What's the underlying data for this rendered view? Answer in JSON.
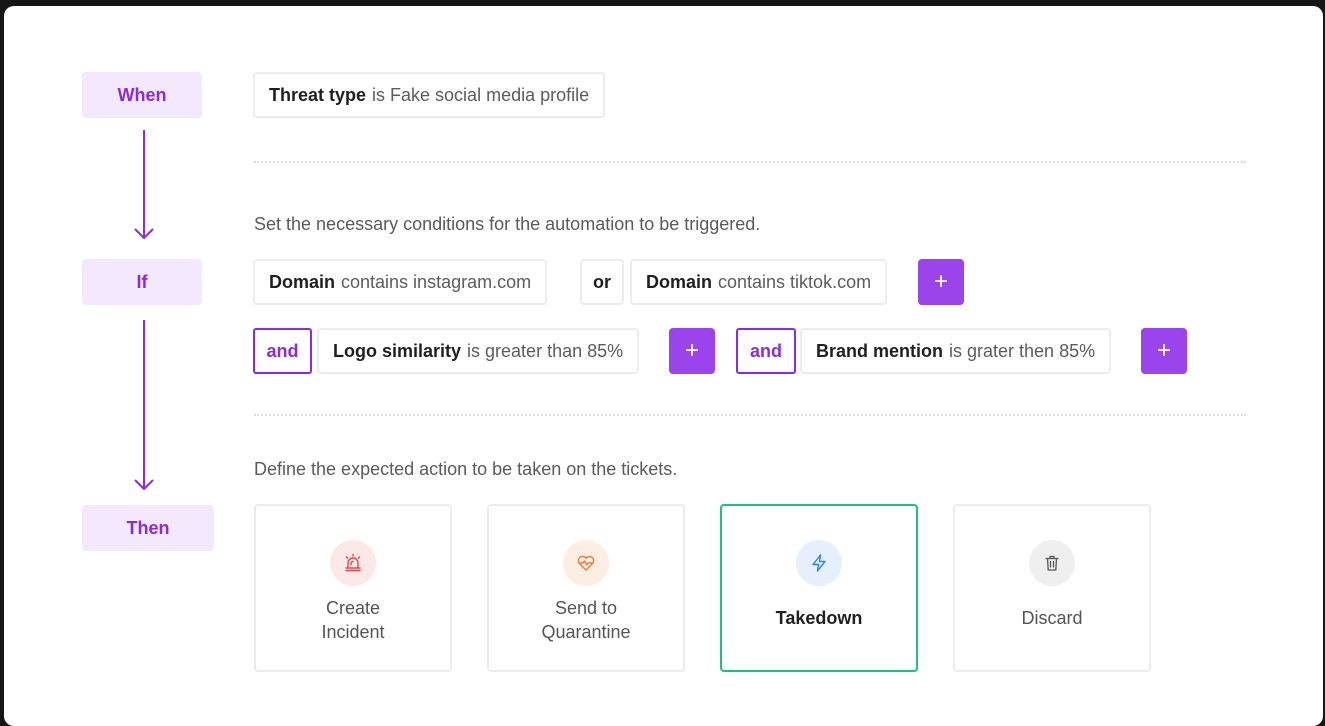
{
  "stages": {
    "when": "When",
    "if": "If",
    "then": "Then"
  },
  "when_condition": {
    "key": "Threat type",
    "value": "is Fake social media profile"
  },
  "if_hint": "Set the necessary conditions for the automation to be triggered.",
  "if_row1": {
    "cond1": {
      "key": "Domain",
      "value": "contains instagram.com"
    },
    "or_label": "or",
    "cond2": {
      "key": "Domain",
      "value": "contains tiktok.com"
    },
    "add_label": "+"
  },
  "if_row2": {
    "and1": "and",
    "cond3": {
      "key": "Logo similarity",
      "value": "is greater than 85%"
    },
    "and2": "and",
    "cond4": {
      "key": "Brand mention",
      "value": "is grater then 85%"
    },
    "add_label": "+"
  },
  "then_hint": "Define the expected action to be taken on the tickets.",
  "actions": [
    {
      "label_line1": "Create",
      "label_line2": "Incident",
      "icon": "alarm-icon",
      "icon_bg": "#fde8e8",
      "icon_color": "#e5484d"
    },
    {
      "label_line1": "Send to",
      "label_line2": "Quarantine",
      "icon": "heart-pulse-icon",
      "icon_bg": "#fdeee3",
      "icon_color": "#f07a3c"
    },
    {
      "label_line1": "Takedown",
      "icon": "lightning-icon",
      "icon_bg": "#e6f0fd",
      "icon_color": "#2f80ed",
      "selected": true
    },
    {
      "label_line1": "Discard",
      "icon": "trash-icon",
      "icon_bg": "#efefef",
      "icon_color": "#555555"
    }
  ],
  "colors": {
    "accent": "#8a2be2",
    "accent_bg": "#f3e8fd",
    "selected_border": "#1fc17b"
  }
}
